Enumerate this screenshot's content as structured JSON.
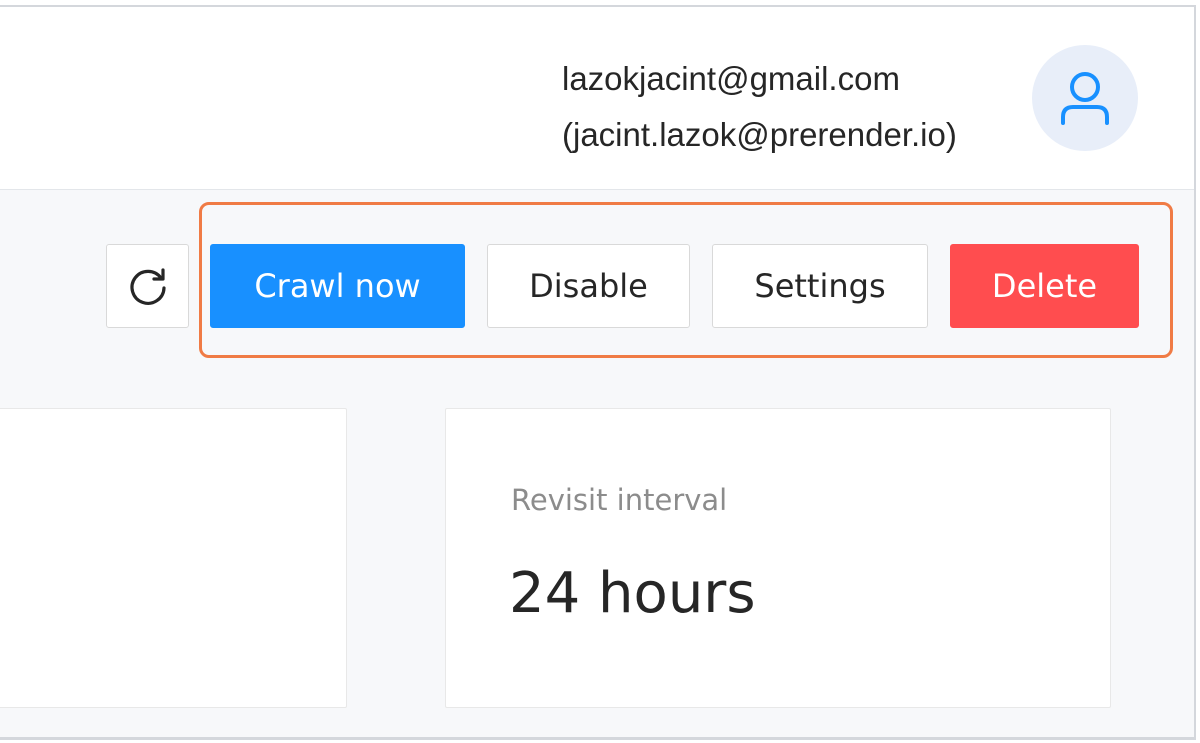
{
  "header": {
    "email": "lazokjacint@gmail.com",
    "account": "(jacint.lazok@prerender.io)",
    "avatar_icon": "user-icon"
  },
  "toolbar": {
    "refresh_icon": "refresh-icon",
    "crawl_label": "Crawl now",
    "disable_label": "Disable",
    "settings_label": "Settings",
    "delete_label": "Delete"
  },
  "stats": {
    "revisit_label": "Revisit interval",
    "revisit_value": "24 hours"
  },
  "colors": {
    "primary": "#1890ff",
    "danger": "#ff4d4f",
    "highlight": "#f07b45",
    "avatar_bg": "#e8eef9"
  }
}
